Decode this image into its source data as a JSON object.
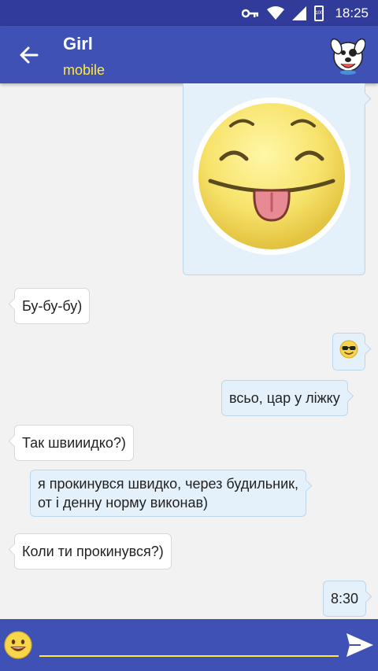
{
  "status_bar": {
    "time": "18:25",
    "battery_label": "100",
    "icons": [
      "key-icon",
      "wifi-icon",
      "signal-icon",
      "battery-icon"
    ]
  },
  "header": {
    "back_icon": "arrow-left-icon",
    "title": "Girl",
    "subtitle": "mobile",
    "avatar_icon": "dog-sticker-icon"
  },
  "messages": [
    {
      "direction": "out",
      "type": "sticker",
      "sticker": "tongue-out-smiley"
    },
    {
      "direction": "in",
      "type": "text",
      "text": "Бу-бу-бу)"
    },
    {
      "direction": "out",
      "type": "emoji",
      "emoji": "sunglasses-smiley-icon"
    },
    {
      "direction": "out",
      "type": "text",
      "text": "всьо, цар у ліжку"
    },
    {
      "direction": "in",
      "type": "text",
      "text": "Так швииидко?)"
    },
    {
      "direction": "out",
      "type": "text",
      "lines": [
        "я прокинувся швидко, через будильник,",
        "от і денну норму виконав)"
      ]
    },
    {
      "direction": "in",
      "type": "text",
      "text": "Коли ти прокинувся?)"
    },
    {
      "direction": "out",
      "type": "text",
      "text": "8:30"
    }
  ],
  "input_bar": {
    "emoji_icon": "smiley-icon",
    "input_value": "",
    "placeholder": "",
    "send_icon": "send-icon"
  },
  "colors": {
    "status_bar": "#303b9a",
    "app_bar": "#3f51b5",
    "accent": "#ffeb3b",
    "outgoing_bubble": "#e4f1fb",
    "incoming_bubble": "#ffffff",
    "chat_background": "#f2f2f2"
  }
}
